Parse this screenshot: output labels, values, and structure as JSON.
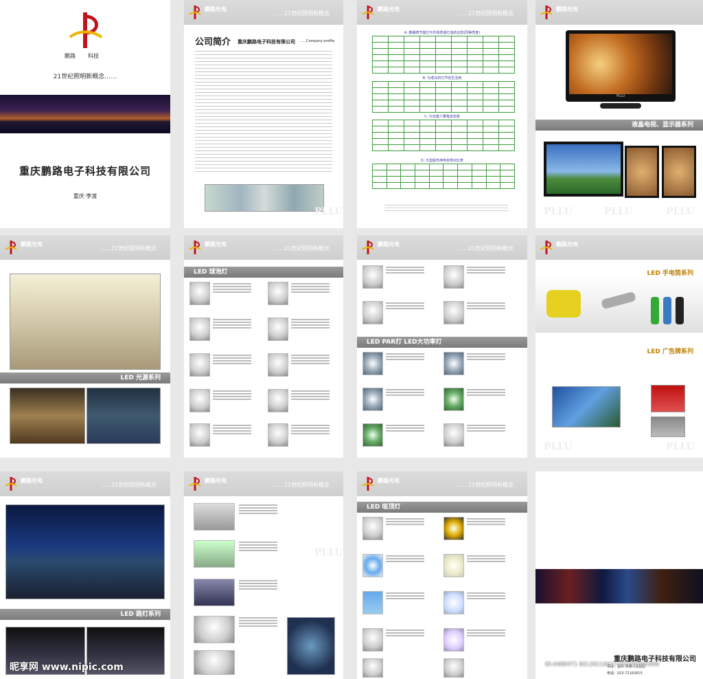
{
  "cover": {
    "logo_text": "鹏路",
    "logo_text2": "科技",
    "slogan": "21世纪照明新概念……",
    "company": "重庆鹏路电子科技有限公司",
    "location": "重庆·李渡"
  },
  "header": {
    "brand": "鹏路光电",
    "slogan": "……21世纪照明新概念"
  },
  "profile": {
    "title": "公司简介",
    "company": "重庆鹏路电子科技有限公司",
    "subtitle": "……Company profile"
  },
  "compare": {
    "caption_a": "A: 鹏路牌节能灯与市场普通灯泡的比较(同等亮度)",
    "caption_b": "B: 为老白炽灯节省生活用",
    "caption_c": "C: 为全套人算笔成本账",
    "caption_d": "D: 大型超市用电省电对比表"
  },
  "sections": {
    "tv": "液晶电视、显示器系列",
    "lights": "LED 光源系列",
    "bulb": "LED 球泡灯",
    "par": "LED PAR灯  LED大功率灯",
    "flashlight": "LED 手电筒系列",
    "billboard": "LED 广告牌系列",
    "street": "LED 路灯系列",
    "ceiling": "LED 吸顶灯"
  },
  "watermark": "PLLU",
  "tv_brand": "PLLU",
  "back": {
    "company": "重庆鹏路电子科技有限公司",
    "addr": "地址：重庆·李渡工业园区",
    "tel": "电话：023-72182815"
  },
  "footer_mark": {
    "site": "昵享网 www.nipic.com",
    "id": "ID:4488471 NO:20110627103240345000"
  },
  "colors": {
    "brand_red": "#c0141c",
    "brand_yellow": "#f0b400",
    "band_gray": "#8a8a8a",
    "table_green": "#3a9a3a"
  }
}
